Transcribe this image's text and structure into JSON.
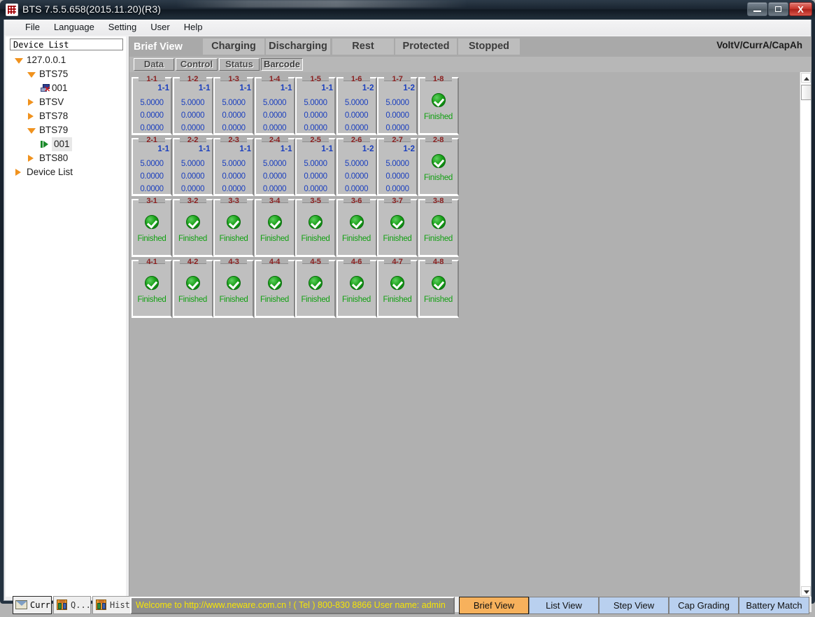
{
  "window": {
    "title": "BTS 7.5.5.658(2015.11.20)(R3)",
    "app_icon": "bts-grid-icon",
    "minimize": "–",
    "maximize": "□",
    "close": "X"
  },
  "menu": [
    {
      "label": "File",
      "accel": "F"
    },
    {
      "label": "Language",
      "accel": "L"
    },
    {
      "label": "Setting",
      "accel": "S"
    },
    {
      "label": "User",
      "accel": "U"
    },
    {
      "label": "Help",
      "accel": "H"
    }
  ],
  "sidebar": {
    "header": "Device List",
    "tree": [
      {
        "label": "127.0.0.1",
        "indent": 0,
        "marker": "arrow-down",
        "selected": false
      },
      {
        "label": "BTS75",
        "indent": 1,
        "marker": "arrow-down",
        "selected": false
      },
      {
        "label": "001",
        "indent": 2,
        "marker": "device-offline-icon",
        "selected": false
      },
      {
        "label": "BTSV",
        "indent": 1,
        "marker": "arrow-right",
        "selected": false
      },
      {
        "label": "BTS78",
        "indent": 1,
        "marker": "arrow-right",
        "selected": false
      },
      {
        "label": "BTS79",
        "indent": 1,
        "marker": "arrow-down",
        "selected": false
      },
      {
        "label": "001",
        "indent": 2,
        "marker": "arrow-green",
        "selected": true
      },
      {
        "label": "BTS80",
        "indent": 1,
        "marker": "arrow-right",
        "selected": false
      },
      {
        "label": "Device List",
        "indent": 0,
        "marker": "arrow-right",
        "selected": false
      }
    ],
    "buttons": [
      {
        "label": "Curr",
        "icon": "envelope-icon",
        "active": true
      },
      {
        "label": "Q...",
        "icon": "building-icon",
        "active": false
      },
      {
        "label": "Hist",
        "icon": "building-icon",
        "active": false
      }
    ]
  },
  "state_tabs": [
    {
      "label": "Brief View",
      "primary": true
    },
    {
      "label": "Charging",
      "primary": false
    },
    {
      "label": "Discharging",
      "primary": false
    },
    {
      "label": "Rest",
      "primary": false
    },
    {
      "label": "Protected",
      "primary": false
    },
    {
      "label": "Stopped",
      "primary": false
    }
  ],
  "units_label": "VoltV/CurrA/CapAh",
  "expand_button": "»",
  "sub_tabs": [
    {
      "label": "Data",
      "selected": false
    },
    {
      "label": "Control",
      "selected": false
    },
    {
      "label": "Status",
      "selected": false
    },
    {
      "label": "Barcode",
      "selected": true
    }
  ],
  "channels": [
    {
      "id": "1-1",
      "step": "1-1",
      "v1": "5.0000",
      "v2": "0.0000",
      "v3": "0.0000",
      "state": "data"
    },
    {
      "id": "1-2",
      "step": "1-1",
      "v1": "5.0000",
      "v2": "0.0000",
      "v3": "0.0000",
      "state": "data"
    },
    {
      "id": "1-3",
      "step": "1-1",
      "v1": "5.0000",
      "v2": "0.0000",
      "v3": "0.0000",
      "state": "data"
    },
    {
      "id": "1-4",
      "step": "1-1",
      "v1": "5.0000",
      "v2": "0.0000",
      "v3": "0.0000",
      "state": "data"
    },
    {
      "id": "1-5",
      "step": "1-1",
      "v1": "5.0000",
      "v2": "0.0000",
      "v3": "0.0000",
      "state": "data"
    },
    {
      "id": "1-6",
      "step": "1-2",
      "v1": "5.0000",
      "v2": "0.0000",
      "v3": "0.0000",
      "state": "data"
    },
    {
      "id": "1-7",
      "step": "1-2",
      "v1": "5.0000",
      "v2": "0.0000",
      "v3": "0.0000",
      "state": "data"
    },
    {
      "id": "1-8",
      "status": "Finished",
      "state": "finished"
    },
    {
      "id": "2-1",
      "step": "1-1",
      "v1": "5.0000",
      "v2": "0.0000",
      "v3": "0.0000",
      "state": "data"
    },
    {
      "id": "2-2",
      "step": "1-1",
      "v1": "5.0000",
      "v2": "0.0000",
      "v3": "0.0000",
      "state": "data"
    },
    {
      "id": "2-3",
      "step": "1-1",
      "v1": "5.0000",
      "v2": "0.0000",
      "v3": "0.0000",
      "state": "data"
    },
    {
      "id": "2-4",
      "step": "1-1",
      "v1": "5.0000",
      "v2": "0.0000",
      "v3": "0.0000",
      "state": "data"
    },
    {
      "id": "2-5",
      "step": "1-1",
      "v1": "5.0000",
      "v2": "0.0000",
      "v3": "0.0000",
      "state": "data"
    },
    {
      "id": "2-6",
      "step": "1-2",
      "v1": "5.0000",
      "v2": "0.0000",
      "v3": "0.0000",
      "state": "data"
    },
    {
      "id": "2-7",
      "step": "1-2",
      "v1": "5.0000",
      "v2": "0.0000",
      "v3": "0.0000",
      "state": "data"
    },
    {
      "id": "2-8",
      "status": "Finished",
      "state": "finished"
    },
    {
      "id": "3-1",
      "status": "Finished",
      "state": "finished"
    },
    {
      "id": "3-2",
      "status": "Finished",
      "state": "finished"
    },
    {
      "id": "3-3",
      "status": "Finished",
      "state": "finished"
    },
    {
      "id": "3-4",
      "status": "Finished",
      "state": "finished"
    },
    {
      "id": "3-5",
      "status": "Finished",
      "state": "finished"
    },
    {
      "id": "3-6",
      "status": "Finished",
      "state": "finished"
    },
    {
      "id": "3-7",
      "status": "Finished",
      "state": "finished"
    },
    {
      "id": "3-8",
      "status": "Finished",
      "state": "finished"
    },
    {
      "id": "4-1",
      "status": "Finished",
      "state": "finished"
    },
    {
      "id": "4-2",
      "status": "Finished",
      "state": "finished"
    },
    {
      "id": "4-3",
      "status": "Finished",
      "state": "finished"
    },
    {
      "id": "4-4",
      "status": "Finished",
      "state": "finished"
    },
    {
      "id": "4-5",
      "status": "Finished",
      "state": "finished"
    },
    {
      "id": "4-6",
      "status": "Finished",
      "state": "finished"
    },
    {
      "id": "4-7",
      "status": "Finished",
      "state": "finished"
    },
    {
      "id": "4-8",
      "status": "Finished",
      "state": "finished"
    }
  ],
  "status_bar": "Welcome to http://www.neware.com.cn !    ( Tel ) 800-830 8866  User name: admin",
  "view_buttons": [
    {
      "label": "Brief View",
      "active": true
    },
    {
      "label": "List View",
      "active": false
    },
    {
      "label": "Step View",
      "active": false
    },
    {
      "label": "Cap Grading",
      "active": false
    },
    {
      "label": "Battery Match",
      "active": false
    }
  ],
  "colors": {
    "accent_orange": "#f7b15c",
    "finished_green": "#12a012",
    "channel_id_red": "#8a1f1f",
    "value_blue": "#1b3fbe",
    "status_yellow": "#f6e505",
    "highlight_red": "#e81c1c"
  }
}
